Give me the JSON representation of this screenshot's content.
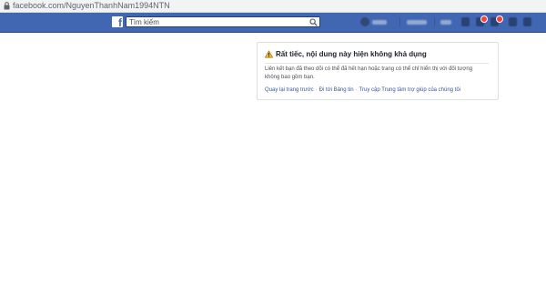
{
  "browser": {
    "url": "facebook.com/NguyenThanhNam1994NTN"
  },
  "header": {
    "logo_letter": "f",
    "search_placeholder": "Tìm kiếm"
  },
  "error": {
    "title": "Rất tiếc, nội dung này hiện không khả dụng",
    "message": "Liên kết bạn đã theo dõi có thể đã hết hạn hoặc trang có thể chỉ hiển thị với đối tượng không bao gồm bạn.",
    "links": {
      "back": "Quay lại trang trước",
      "feed": "Đi tới Bảng tin",
      "help": "Truy cập Trung tâm trợ giúp của chúng tôi"
    },
    "separator": "·"
  },
  "colors": {
    "fb_blue": "#4267b2",
    "link": "#385898"
  },
  "icons": [
    "lock-icon",
    "facebook-logo",
    "search-icon",
    "warning-icon"
  ]
}
